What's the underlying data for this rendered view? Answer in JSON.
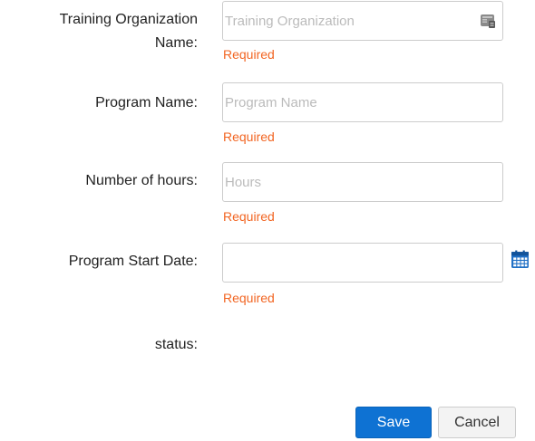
{
  "form": {
    "training_org": {
      "label_line1": "Training Organization",
      "label_line2": "Name:",
      "placeholder": "Training Organization",
      "value": "",
      "error": "Required",
      "icon": "contact-card-icon"
    },
    "program_name": {
      "label": "Program Name:",
      "placeholder": "Program Name",
      "value": "",
      "error": "Required"
    },
    "hours": {
      "label": "Number of hours:",
      "placeholder": "Hours",
      "value": "",
      "error": "Required"
    },
    "start_date": {
      "label": "Program Start Date:",
      "placeholder": "",
      "value": "",
      "error": "Required",
      "icon": "calendar-icon"
    },
    "status": {
      "label": "status:"
    }
  },
  "actions": {
    "save_label": "Save",
    "cancel_label": "Cancel"
  },
  "colors": {
    "error": "#f26522",
    "primary": "#0e72d3",
    "calendar_icon": "#1f6fc5",
    "card_icon": "#8a8a8a"
  }
}
